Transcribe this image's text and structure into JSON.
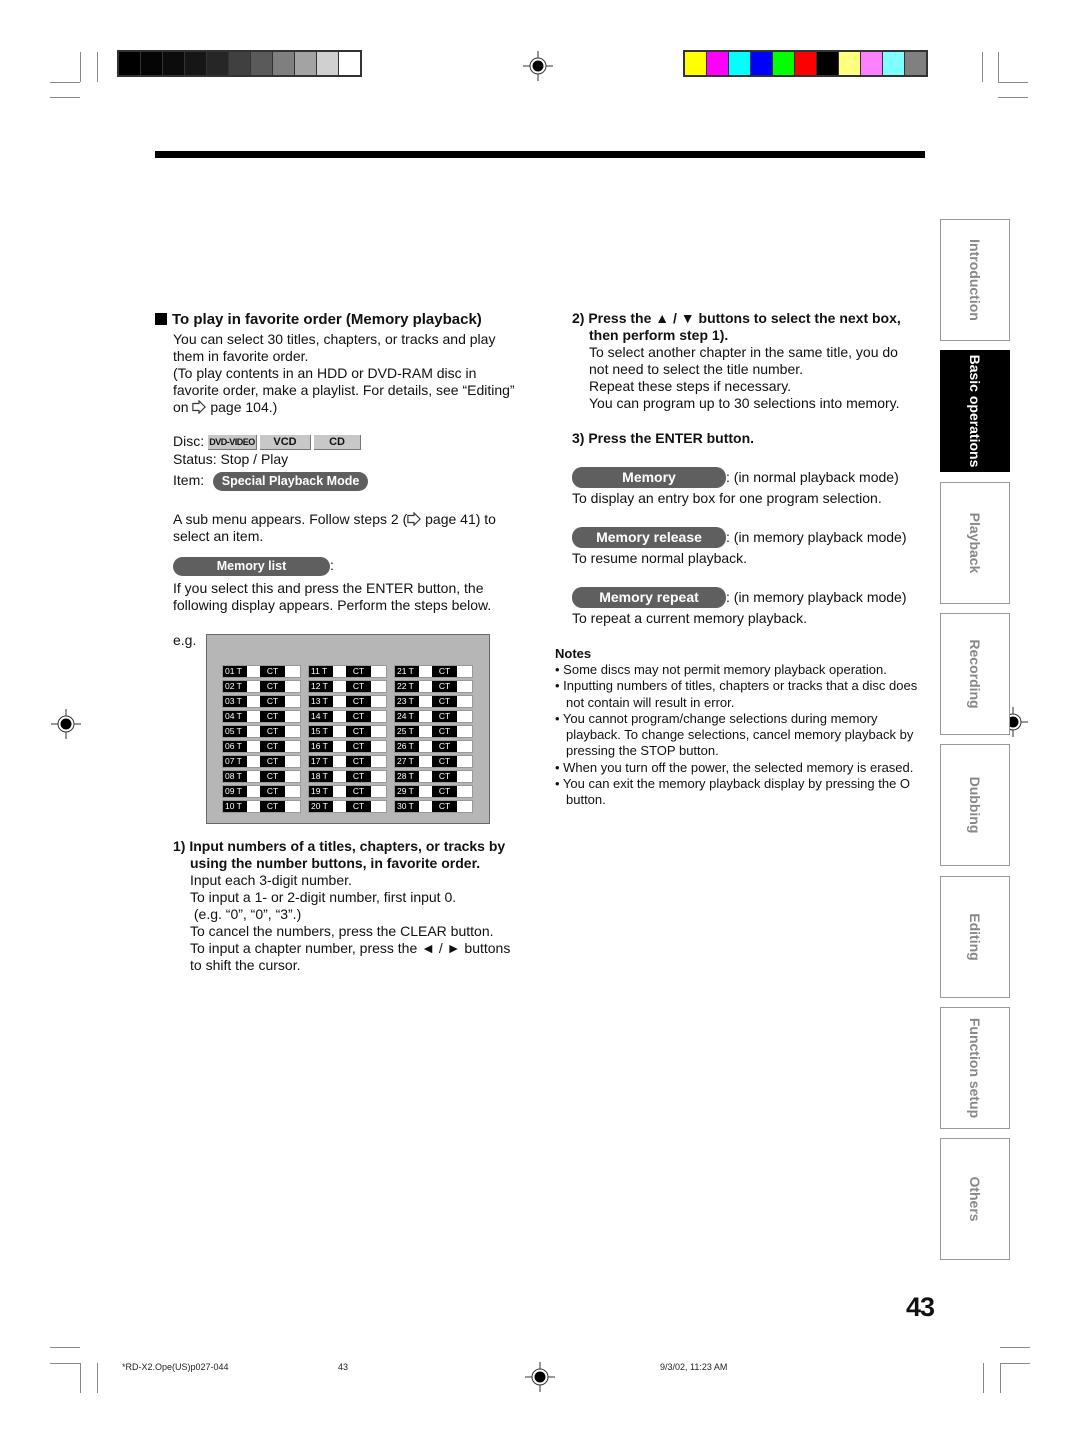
{
  "color_bars": {
    "gray": [
      "#000000",
      "#050505",
      "#0c0c0c",
      "#161616",
      "#262626",
      "#404040",
      "#5a5a5a",
      "#7f7f7f",
      "#a3a3a3",
      "#d0d0d0",
      "#ffffff"
    ],
    "color": [
      "#ffff00",
      "#ff00ff",
      "#00ffff",
      "#0000ff",
      "#00ff00",
      "#ff0000",
      "#000000",
      "#ffff80",
      "#ff80ff",
      "#80ffff",
      "#808080"
    ]
  },
  "section": {
    "heading": "To play in favorite order (Memory playback)",
    "intro_1": "You can select 30 titles, chapters, or tracks and play them in favorite order.",
    "intro_2_pre": "(To play contents in an HDD or DVD-RAM disc in favorite order, make a playlist. For details, see “Editing” on",
    "intro_2_post": "page 104.)",
    "disc_label": "Disc:",
    "discs": [
      "DVD-VIDEO",
      "VCD",
      "CD"
    ],
    "status": "Status: Stop / Play",
    "item_label": "Item:",
    "item_pill": "Special Playback Mode",
    "submenu_pre": "A sub menu appears. Follow steps 2 (",
    "submenu_post": "page 41) to select an item.",
    "memory_list_pill": "Memory list",
    "colon": ":",
    "memory_list_desc": "If you select this and press the ENTER button, the following display appears. Perform the steps below.",
    "eg_label": "e.g."
  },
  "memory_screen": {
    "title_suffix": "T",
    "chapter_label": "CT",
    "entries": [
      "01",
      "02",
      "03",
      "04",
      "05",
      "06",
      "07",
      "08",
      "09",
      "10",
      "11",
      "12",
      "13",
      "14",
      "15",
      "16",
      "17",
      "18",
      "19",
      "20",
      "21",
      "22",
      "23",
      "24",
      "25",
      "26",
      "27",
      "28",
      "29",
      "30"
    ]
  },
  "steps": {
    "step1_title": "1) Input numbers of a titles, chapters, or tracks by using the number buttons, in favorite order.",
    "step1_lines": [
      "Input each 3-digit number.",
      "To input a 1- or 2-digit number, first input 0.",
      " (e.g. “0”, “0”, “3”.)",
      "To cancel the numbers, press the CLEAR button.",
      "To input a chapter number, press the ◄ / ► buttons to shift the cursor."
    ],
    "step2_title": "2) Press the ▲ / ▼ buttons to select the next box, then perform step 1).",
    "step2_lines": [
      "To select another chapter in the same title, you do not need to select the title number.",
      "Repeat these steps if necessary.",
      "You can program up to 30 selections into memory."
    ],
    "step3_title": "3) Press the ENTER button."
  },
  "options": [
    {
      "pill": "Memory",
      "mode": ": (in normal playback mode)",
      "desc": "To display an entry box for one program selection."
    },
    {
      "pill": "Memory release",
      "mode": ": (in memory playback mode)",
      "desc": "To resume normal playback."
    },
    {
      "pill": "Memory repeat",
      "mode": ": (in memory playback mode)",
      "desc": "To repeat a current memory playback."
    }
  ],
  "notes": {
    "title": "Notes",
    "items": [
      "• Some discs may not permit memory playback operation.",
      "• Inputting numbers of titles, chapters or tracks that a disc does not contain will result in error.",
      "• You cannot program/change selections during memory playback. To change selections, cancel memory playback by pressing the STOP button.",
      "• When you turn off the power, the selected memory is erased.",
      "• You can exit the memory playback display by pressing the O button."
    ]
  },
  "side_tabs": [
    {
      "label": "Introduction",
      "active": false
    },
    {
      "label": "Basic operations",
      "active": true
    },
    {
      "label": "Playback",
      "active": false
    },
    {
      "label": "Recording",
      "active": false
    },
    {
      "label": "Dubbing",
      "active": false
    },
    {
      "label": "Editing",
      "active": false
    },
    {
      "label": "Function setup",
      "active": false
    },
    {
      "label": "Others",
      "active": false
    }
  ],
  "page_number": "43",
  "footer": {
    "file": "*RD-X2.Ope(US)p027-044",
    "page": "43",
    "timestamp": "9/3/02, 11:23 AM"
  }
}
